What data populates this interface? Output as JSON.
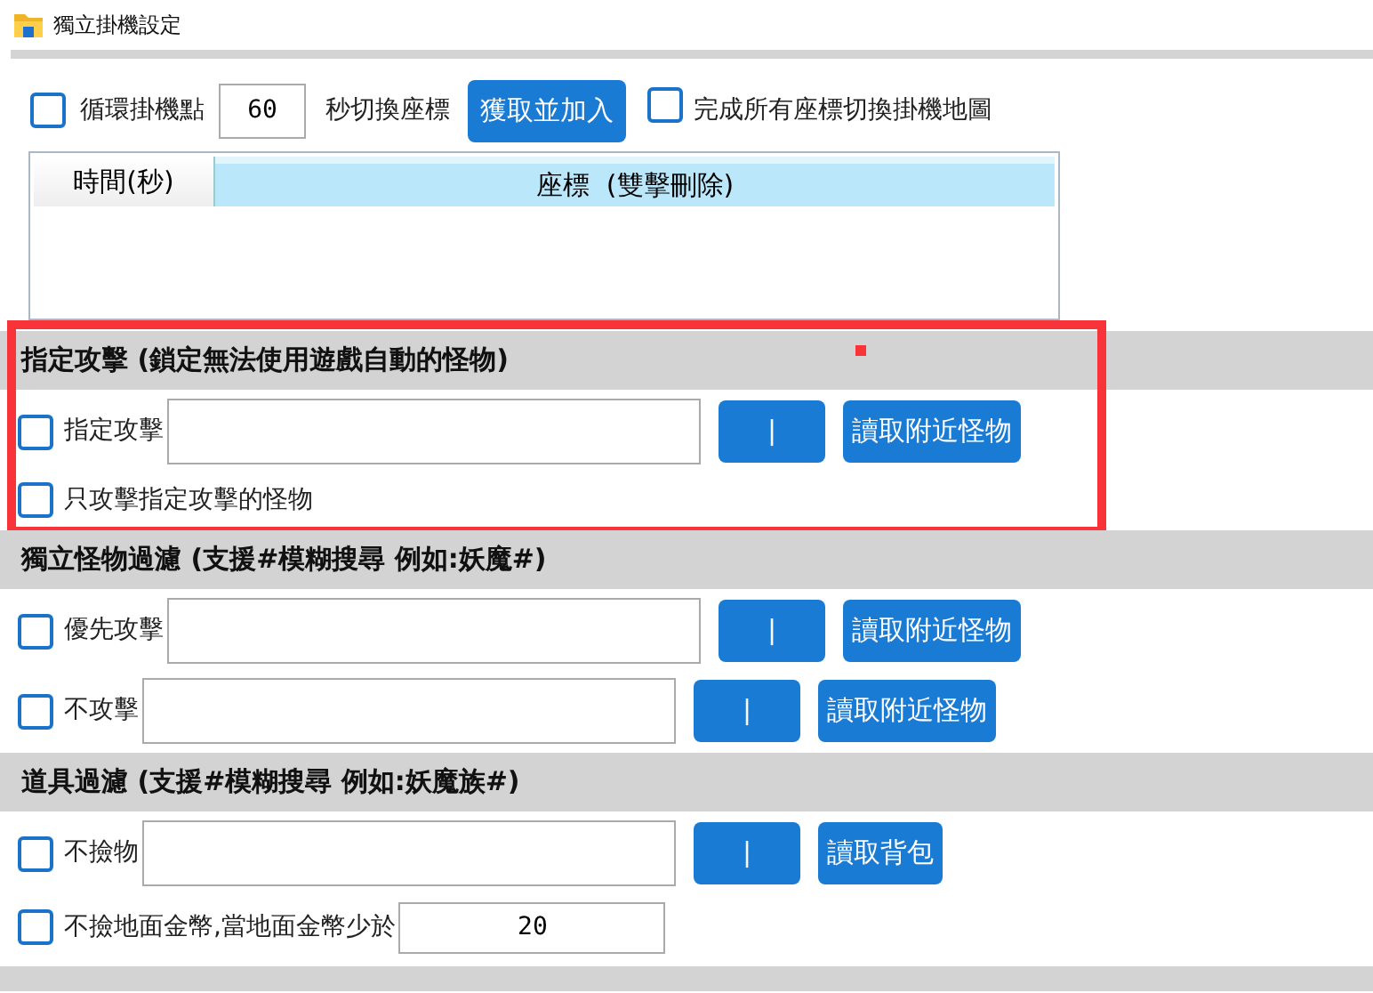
{
  "window": {
    "title": "獨立掛機設定"
  },
  "loop": {
    "checkbox_label": "循環掛機點",
    "checked": false,
    "seconds": "60",
    "seconds_label": "秒切換座標",
    "add_button": "獲取並加入",
    "switch_label": "完成所有座標切換掛機地圖",
    "switch_checked": false
  },
  "table": {
    "columns": [
      "時間(秒)",
      "座標  (雙擊刪除)"
    ]
  },
  "sections": [
    {
      "title": "指定攻擊 (鎖定無法使用遊戲自動的怪物)",
      "highlighted": true,
      "rows": [
        {
          "kind": "input_row",
          "label": "指定攻擊",
          "checked": false,
          "value_button": "|",
          "read_button": "讀取附近怪物"
        },
        {
          "kind": "checkbox",
          "label": "只攻擊指定攻擊的怪物",
          "checked": false
        }
      ]
    },
    {
      "title": "獨立怪物過濾 (支援#模糊搜尋 例如:妖魔#)",
      "highlighted": false,
      "rows": [
        {
          "kind": "input_row",
          "label": "優先攻擊",
          "checked": false,
          "value_button": "|",
          "read_button": "讀取附近怪物"
        },
        {
          "kind": "input_row",
          "label": "不攻擊",
          "checked": false,
          "value_button": "|",
          "read_button": "讀取附近怪物"
        }
      ]
    },
    {
      "title": "道具過濾 (支援#模糊搜尋 例如:妖魔族#)",
      "highlighted": false,
      "rows": [
        {
          "kind": "input_row",
          "label": "不撿物",
          "checked": false,
          "value_button": "|",
          "read_button": "讀取背包"
        },
        {
          "kind": "number_row",
          "label": "不撿地面金幣,當地面金幣少於",
          "checked": false,
          "value": "20"
        }
      ]
    }
  ]
}
